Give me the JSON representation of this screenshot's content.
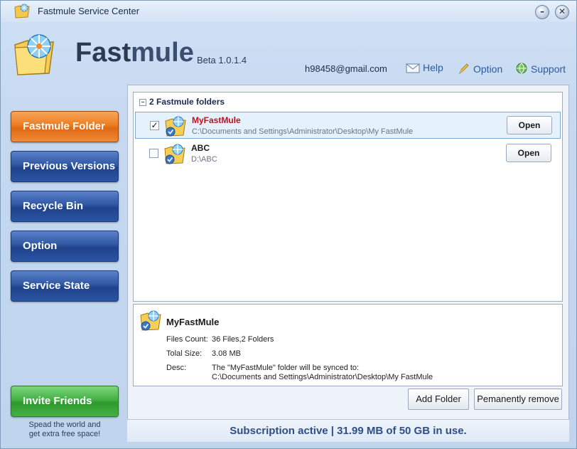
{
  "window": {
    "title": "Fastmule Service Center",
    "minimize_glyph": "–",
    "close_glyph": "✕"
  },
  "header": {
    "brand_part1": "Fast",
    "brand_part2": "mule",
    "version": "Beta 1.0.1.4",
    "email": "h98458@gmail.com",
    "links": {
      "help": "Help",
      "option": "Option",
      "support": "Support"
    }
  },
  "sidebar": {
    "items": [
      {
        "label": "Fastmule Folder",
        "active": true
      },
      {
        "label": "Previous Versions"
      },
      {
        "label": "Recycle Bin"
      },
      {
        "label": "Option"
      },
      {
        "label": "Service State"
      }
    ],
    "invite": {
      "label": "Invite Friends",
      "note_line1": "Spead the world and",
      "note_line2": "get extra free space!"
    }
  },
  "folders": {
    "header": "2 Fastmule folders",
    "expander": "−",
    "items": [
      {
        "name": "MyFastMule",
        "path": "C:\\Documents and Settings\\Administrator\\Desktop\\My FastMule",
        "checked": "✓",
        "open_label": "Open"
      },
      {
        "name": "ABC",
        "path": "D:\\ABC",
        "checked": "",
        "open_label": "Open"
      }
    ]
  },
  "details": {
    "name": "MyFastMule",
    "files_count_label": "Files Count:",
    "files_count_value": "36 Files,2 Folders",
    "total_size_label": "Tolal Size:",
    "total_size_value": "3.08 MB",
    "desc_label": "Desc:",
    "desc_line1": "The \"MyFastMule\" folder will be synced to:",
    "desc_line2": "C:\\Documents and Settings\\Administrator\\Desktop\\My FastMule"
  },
  "actions": {
    "add_folder": "Add Folder",
    "permanently_remove": "Pemanently remove"
  },
  "status": {
    "text": "Subscription active | 31.99 MB of 50 GB in use."
  },
  "colors": {
    "accent_orange": "#ee7d22",
    "nav_blue": "#2f57a3",
    "invite_green": "#44b044",
    "selected_name": "#c0101a"
  }
}
